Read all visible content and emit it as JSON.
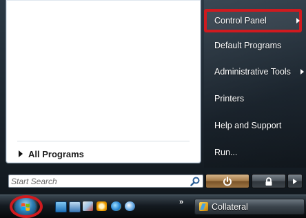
{
  "start_menu": {
    "all_programs_label": "All Programs",
    "search_placeholder": "Start Search",
    "right_pane": {
      "items": [
        {
          "label": "Control Panel",
          "has_submenu": true,
          "highlighted": true
        },
        {
          "label": "Default Programs",
          "has_submenu": false
        },
        {
          "label": "Administrative Tools",
          "has_submenu": true
        },
        {
          "label": "Printers",
          "has_submenu": false
        },
        {
          "label": "Help and Support",
          "has_submenu": false
        },
        {
          "label": "Run...",
          "has_submenu": false
        }
      ]
    },
    "power_buttons": {
      "power_icon": "power-icon",
      "lock_icon": "lock-icon",
      "more_icon": "arrow-right-icon"
    }
  },
  "taskbar": {
    "start_orb_icon": "windows-logo-icon",
    "quick_launch_icons": [
      "show-desktop-icon",
      "switch-windows-icon",
      "network-icon",
      "clock-icon",
      "internet-explorer-icon",
      "media-player-icon"
    ],
    "overflow_chevron": "»",
    "task_buttons": [
      {
        "label": "Collateral",
        "icon": "folder-icon"
      }
    ]
  },
  "colors": {
    "highlight_border": "#d01a1f",
    "power_button": "#a67c4a"
  }
}
